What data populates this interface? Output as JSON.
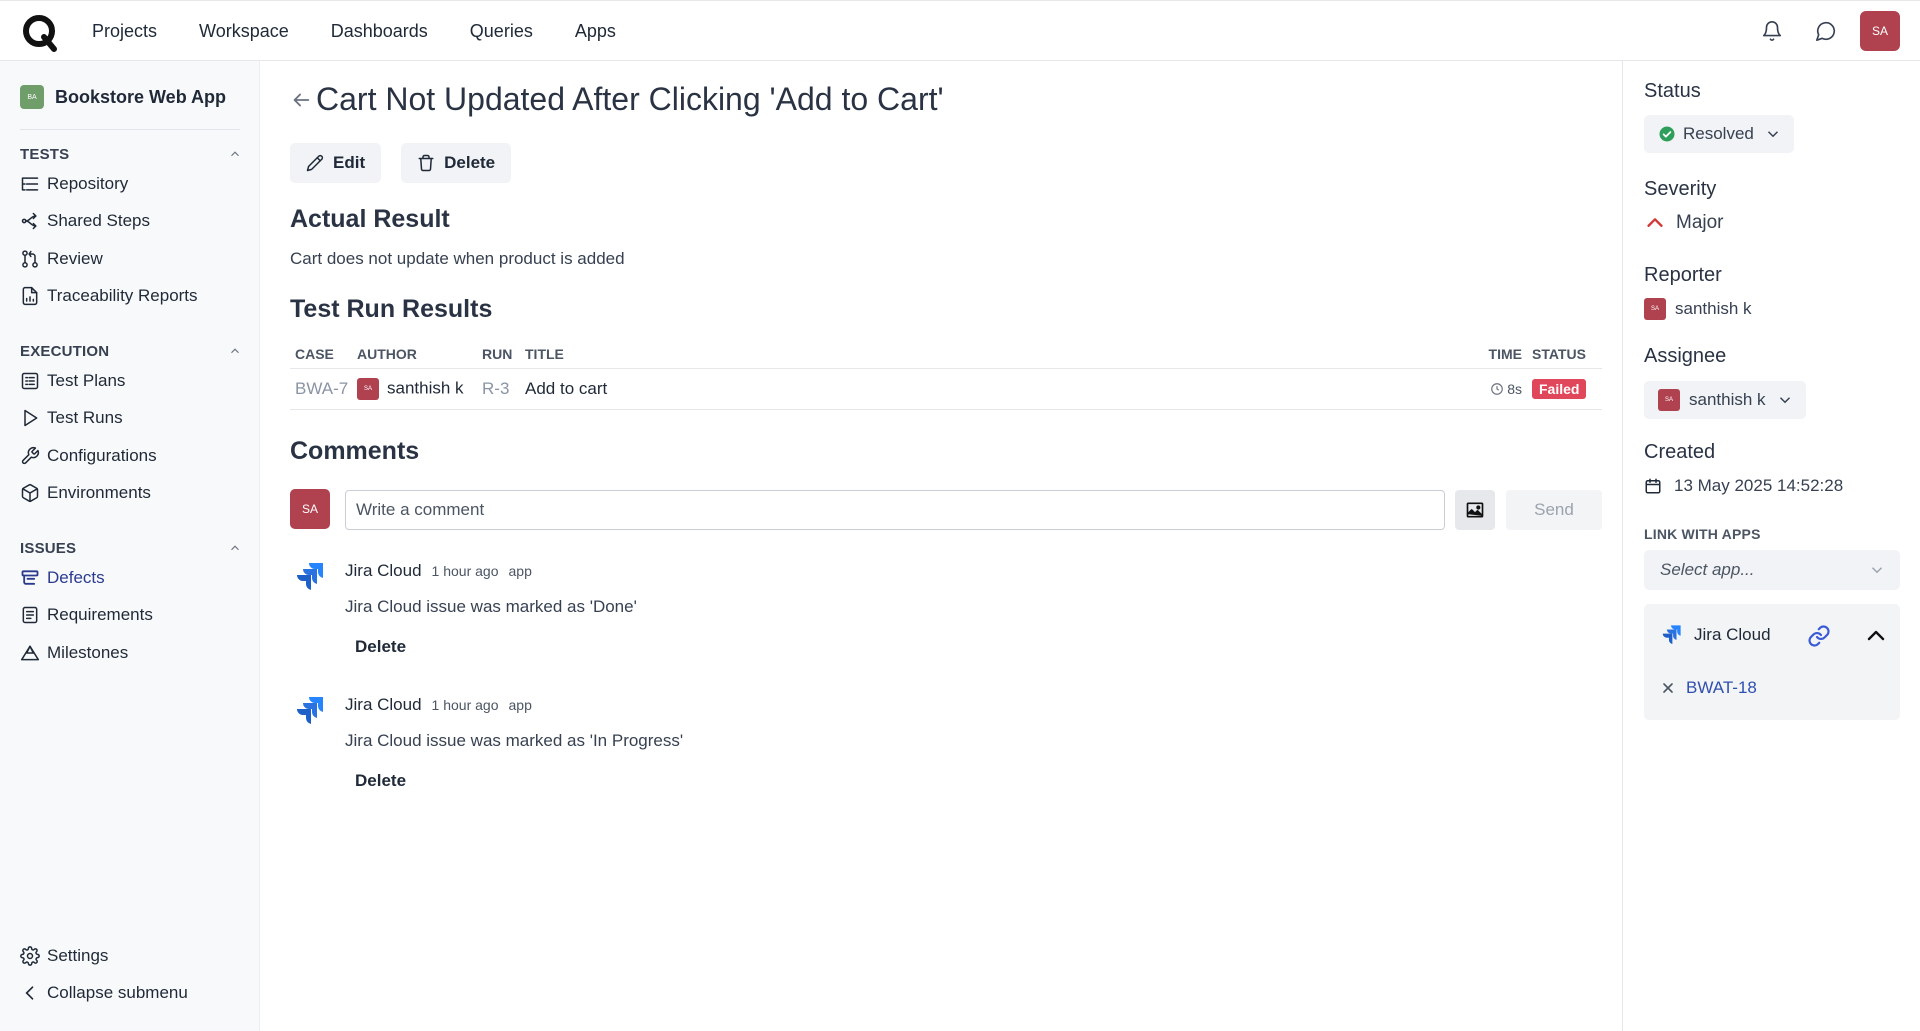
{
  "topnav": {
    "items": [
      "Projects",
      "Workspace",
      "Dashboards",
      "Queries",
      "Apps"
    ],
    "user_initials": "SA"
  },
  "sidebar": {
    "project_badge": "BA",
    "project_name": "Bookstore Web App",
    "sections": [
      {
        "title": "TESTS",
        "items": [
          "Repository",
          "Shared Steps",
          "Review",
          "Traceability Reports"
        ]
      },
      {
        "title": "EXECUTION",
        "items": [
          "Test Plans",
          "Test Runs",
          "Configurations",
          "Environments"
        ]
      },
      {
        "title": "ISSUES",
        "items": [
          "Defects",
          "Requirements",
          "Milestones"
        ]
      }
    ],
    "settings": "Settings",
    "collapse": "Collapse submenu"
  },
  "main": {
    "title": "Cart Not Updated After Clicking 'Add to Cart'",
    "edit_label": "Edit",
    "delete_label": "Delete",
    "actual_result_heading": "Actual Result",
    "actual_result_text": "Cart does not update when product is added",
    "results_heading": "Test Run Results",
    "table": {
      "headers": [
        "CASE",
        "AUTHOR",
        "RUN",
        "TITLE",
        "TIME",
        "STATUS"
      ],
      "rows": [
        {
          "case": "BWA-7",
          "author_initials": "SA",
          "author": "santhish k",
          "run": "R-3",
          "title": "Add to cart",
          "time": "8s",
          "status": "Failed"
        }
      ]
    },
    "comments_heading": "Comments",
    "comment_avatar": "SA",
    "comment_placeholder": "Write a comment",
    "send_label": "Send",
    "comments": [
      {
        "author": "Jira Cloud",
        "time": "1 hour ago",
        "tag": "app",
        "text": "Jira Cloud issue was marked as 'Done'",
        "delete": "Delete"
      },
      {
        "author": "Jira Cloud",
        "time": "1 hour ago",
        "tag": "app",
        "text": "Jira Cloud issue was marked as 'In Progress'",
        "delete": "Delete"
      }
    ]
  },
  "right": {
    "status_label": "Status",
    "status_value": "Resolved",
    "severity_label": "Severity",
    "severity_value": "Major",
    "reporter_label": "Reporter",
    "reporter_initials": "SA",
    "reporter_name": "santhish k",
    "assignee_label": "Assignee",
    "assignee_initials": "SA",
    "assignee_name": "santhish k",
    "created_label": "Created",
    "created_value": "13 May 2025 14:52:28",
    "link_apps_label": "LINK WITH APPS",
    "select_placeholder": "Select app...",
    "jira_name": "Jira Cloud",
    "jira_issue": "BWAT-18"
  },
  "colors": {
    "accent": "#2b3c8f",
    "avatar": "#b0414f",
    "failed": "#e0475a",
    "resolved": "#2e9e5b",
    "jira_blue": "#2f6fde"
  }
}
